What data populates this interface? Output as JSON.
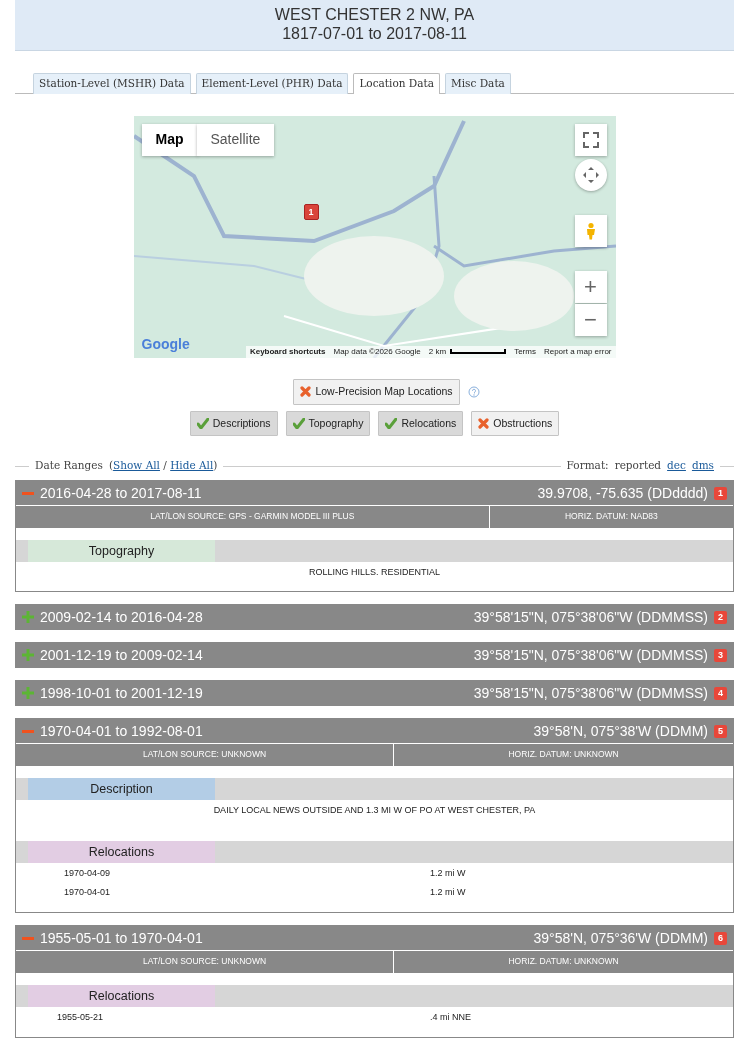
{
  "header": {
    "title": "WEST CHESTER 2 NW, PA",
    "period": "1817-07-01 to 2017-08-11"
  },
  "tabs": [
    {
      "label": "Station-Level (MSHR) Data",
      "selected": false
    },
    {
      "label": "Element-Level (PHR) Data",
      "selected": false
    },
    {
      "label": "Location Data",
      "selected": true
    },
    {
      "label": "Misc Data",
      "selected": false
    }
  ],
  "map": {
    "type_buttons": [
      {
        "label": "Map",
        "selected": true
      },
      {
        "label": "Satellite",
        "selected": false
      }
    ],
    "markers": [
      {
        "label": "1"
      }
    ],
    "zoom_in": "+",
    "zoom_out": "−",
    "logo": "Google",
    "footer": [
      {
        "text": "Keyboard shortcuts",
        "kind": "link"
      },
      {
        "text": "Map data ©2026 Google",
        "kind": "text"
      },
      {
        "text": "2 km",
        "kind": "scale"
      },
      {
        "text": "Terms",
        "kind": "link"
      },
      {
        "text": "Report a map error",
        "kind": "link"
      }
    ]
  },
  "low_precision": {
    "label": "Low-Precision Map Locations",
    "on": false
  },
  "filters": [
    {
      "label": "Descriptions",
      "on": true
    },
    {
      "label": "Topography",
      "on": true
    },
    {
      "label": "Relocations",
      "on": true
    },
    {
      "label": "Obstructions",
      "on": false
    }
  ],
  "date_ranges": {
    "label": "Date Ranges",
    "open": "(",
    "show_all": "Show All",
    "separator": "/",
    "hide_all": "Hide All",
    "close": ")"
  },
  "format": {
    "label": "Format:",
    "options": [
      {
        "label": "reported",
        "selected": true
      },
      {
        "label": "dec",
        "selected": false
      },
      {
        "label": "dms",
        "selected": false
      }
    ]
  },
  "ranges": [
    {
      "dates": "2016-04-28 to 2017-08-11",
      "coords": "39.9708, -75.635 (DDdddd)",
      "marker": "1",
      "expanded": true,
      "source": "LAT/LON SOURCE: GPS - GARMIN MODEL III PLUS",
      "datum": "HORIZ. DATUM: NAD83",
      "sections": [
        {
          "kind": "topography",
          "title": "Topography",
          "text": "ROLLING HILLS. RESIDENTIAL"
        }
      ]
    },
    {
      "dates": "2009-02-14 to 2016-04-28",
      "coords": "39°58'15\"N, 075°38'06\"W (DDMMSS)",
      "marker": "2",
      "expanded": false
    },
    {
      "dates": "2001-12-19 to 2009-02-14",
      "coords": "39°58'15\"N, 075°38'06\"W (DDMMSS)",
      "marker": "3",
      "expanded": false
    },
    {
      "dates": "1998-10-01 to 2001-12-19",
      "coords": "39°58'15\"N, 075°38'06\"W (DDMMSS)",
      "marker": "4",
      "expanded": false
    },
    {
      "dates": "1970-04-01 to 1992-08-01",
      "coords": "39°58'N, 075°38'W (DDMM)",
      "marker": "5",
      "expanded": true,
      "source": "LAT/LON SOURCE: UNKNOWN",
      "datum": "HORIZ. DATUM: UNKNOWN",
      "sections": [
        {
          "kind": "description",
          "title": "Description",
          "text": "DAILY LOCAL NEWS OUTSIDE AND 1.3 MI W OF PO AT WEST CHESTER, PA"
        },
        {
          "kind": "relocations",
          "title": "Relocations",
          "rows": [
            {
              "date": "1970-04-09",
              "distance": "1.2 mi W"
            },
            {
              "date": "1970-04-01",
              "distance": "1.2 mi W"
            }
          ]
        }
      ]
    },
    {
      "dates": "1955-05-01 to 1970-04-01",
      "coords": "39°58'N, 075°36'W (DDMM)",
      "marker": "6",
      "expanded": true,
      "source": "LAT/LON SOURCE: UNKNOWN",
      "datum": "HORIZ. DATUM: UNKNOWN",
      "sections": [
        {
          "kind": "relocations",
          "title": "Relocations",
          "rows": [
            {
              "date": "1955-05-21",
              "distance": ".4 mi NNE"
            }
          ]
        }
      ]
    }
  ]
}
